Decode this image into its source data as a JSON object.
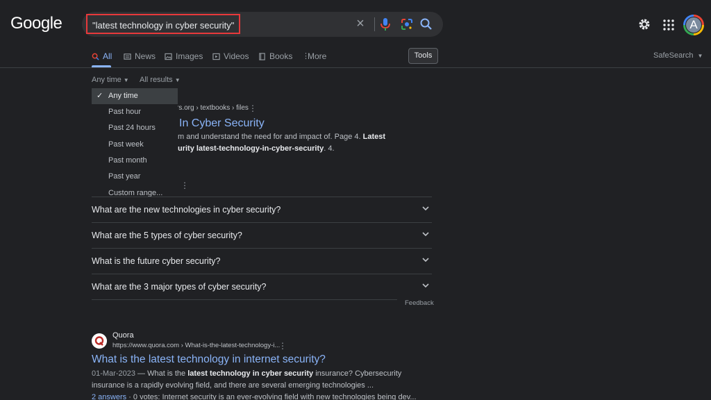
{
  "header": {
    "logo": "Google",
    "search_query": "\"latest technology in cyber security\"",
    "avatar_letter": "A"
  },
  "tabs": [
    {
      "label": "All",
      "icon": "search-icon"
    },
    {
      "label": "News",
      "icon": "news-icon"
    },
    {
      "label": "Images",
      "icon": "image-icon"
    },
    {
      "label": "Videos",
      "icon": "video-icon"
    },
    {
      "label": "Books",
      "icon": "book-icon"
    },
    {
      "label": "More",
      "icon": "more-vert-icon"
    }
  ],
  "tools_label": "Tools",
  "safesearch_label": "SafeSearch",
  "filters": {
    "time": "Any time",
    "results": "All results"
  },
  "time_menu": [
    "Any time",
    "Past hour",
    "Past 24 hours",
    "Past week",
    "Past month",
    "Past year",
    "Custom range..."
  ],
  "result1": {
    "url_fragment": "rs.org › textbooks › files",
    "title_fragment": "In Cyber Security",
    "snippet1_pre": "m and understand the need for and impact of. Page 4. ",
    "snippet1_bold": "Latest",
    "snippet2_bold": "urity latest-technology-in-cyber-security",
    "snippet2_post": ". 4."
  },
  "people_also_ask": [
    "What are the new technologies in cyber security?",
    "What are the 5 types of cyber security?",
    "What is the future cyber security?",
    "What are the 3 major types of cyber security?"
  ],
  "feedback_label": "Feedback",
  "result2": {
    "site_name": "Quora",
    "url": "https://www.quora.com › What-is-the-latest-technology-i...",
    "title": "What is the latest technology in internet security?",
    "date": "01-Mar-2023",
    "snippet1_a": " — What is the ",
    "snippet1_bold": "latest technology in cyber security",
    "snippet1_b": " insurance? Cybersecurity",
    "snippet2": "insurance is a rapidly evolving field, and there are several emerging technologies ...",
    "answers_link": "2 answers",
    "snippet3": " · 0 votes: Internet security is an ever-evolving field with new technologies being dev..."
  }
}
